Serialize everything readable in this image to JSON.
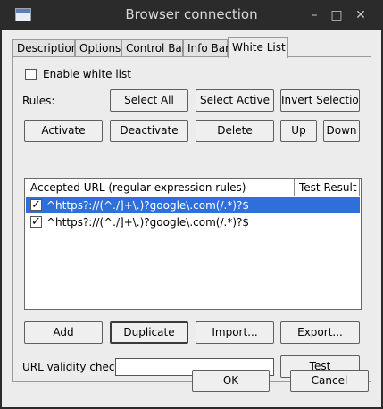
{
  "window": {
    "title": "Browser connection",
    "app_icon": "window-icon"
  },
  "tabs": [
    {
      "label": "Description"
    },
    {
      "label": "Options"
    },
    {
      "label": "Control Bar"
    },
    {
      "label": "Info Bar"
    },
    {
      "label": "White List",
      "active": true
    }
  ],
  "white_list": {
    "enable_label": "Enable white list",
    "enable_checked": false,
    "rules_label": "Rules:",
    "buttons": {
      "select_all": "Select All",
      "select_active": "Select Active",
      "invert_selection": "Invert Selection",
      "activate": "Activate",
      "deactivate": "Deactivate",
      "delete": "Delete",
      "up": "Up",
      "down": "Down",
      "add": "Add",
      "duplicate": "Duplicate",
      "import": "Import...",
      "export": "Export...",
      "test": "Test"
    },
    "columns": [
      "Accepted URL (regular expression rules)",
      "Test Result"
    ],
    "rows": [
      {
        "checked": true,
        "url": "^https?://(^./]+\\.)?google\\.com(/.*)?$",
        "selected": true
      },
      {
        "checked": true,
        "url": "^https?://(^./]+\\.)?google\\.com(/.*)?$",
        "selected": false
      }
    ],
    "url_check_label": "URL validity check",
    "url_check_value": ""
  },
  "dialog_buttons": {
    "ok": "OK",
    "cancel": "Cancel"
  },
  "colors": {
    "selection": "#2f6fd9",
    "titlebar": "#2b2b2b",
    "dialog_bg": "#ececec"
  }
}
